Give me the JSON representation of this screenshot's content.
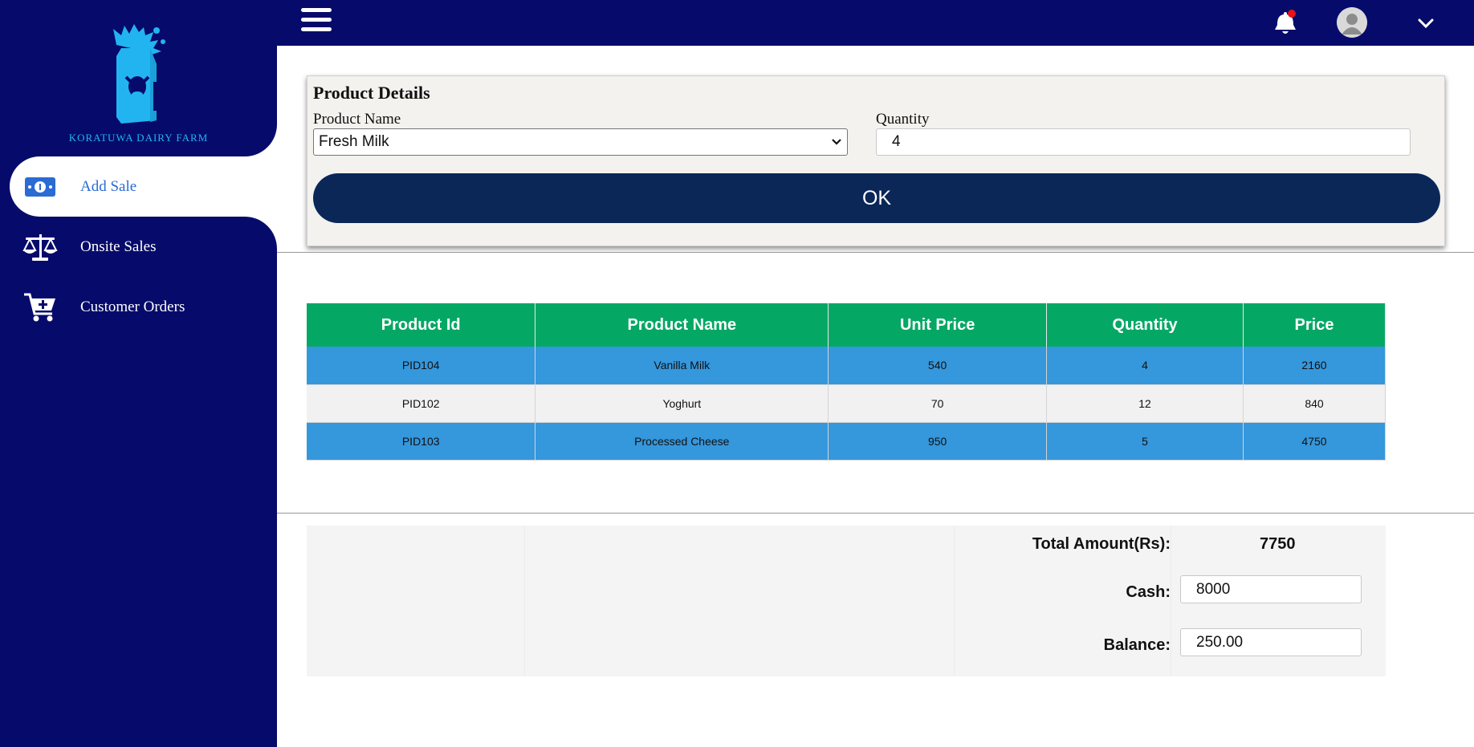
{
  "brand": {
    "name": "KORATUWA DAIRY FARM",
    "accent": "#22b4f0",
    "sidebar_bg": "#060b6b"
  },
  "sidebar": {
    "items": [
      {
        "label": "Add Sale",
        "icon": "money-bill-icon",
        "active": true
      },
      {
        "label": "Onsite Sales",
        "icon": "balance-scale-icon",
        "active": false
      },
      {
        "label": "Customer Orders",
        "icon": "cart-plus-icon",
        "active": false
      }
    ]
  },
  "header": {
    "menu_icon": "hamburger-icon",
    "notification_icon": "bell-icon",
    "has_notification": true,
    "avatar_icon": "user-avatar-icon",
    "dropdown_icon": "chevron-down-icon"
  },
  "product_details": {
    "title": "Product Details",
    "product_name_label": "Product Name",
    "product_name_value": "Fresh Milk",
    "quantity_label": "Quantity",
    "quantity_value": "4",
    "ok_label": "OK",
    "ok_color": "#0a2758"
  },
  "table": {
    "header_color": "#04a864",
    "columns": [
      "Product Id",
      "Product Name",
      "Unit Price",
      "Quantity",
      "Price"
    ],
    "rows": [
      [
        "PID104",
        "Vanilla Milk",
        "540",
        "4",
        "2160"
      ],
      [
        "PID102",
        "Yoghurt",
        "70",
        "12",
        "840"
      ],
      [
        "PID103",
        "Processed Cheese",
        "950",
        "5",
        "4750"
      ]
    ]
  },
  "totals": {
    "total_label": "Total Amount(Rs):",
    "total_value": "7750",
    "cash_label": "Cash:",
    "cash_value": "8000",
    "balance_label": "Balance:",
    "balance_value": "250.00"
  }
}
